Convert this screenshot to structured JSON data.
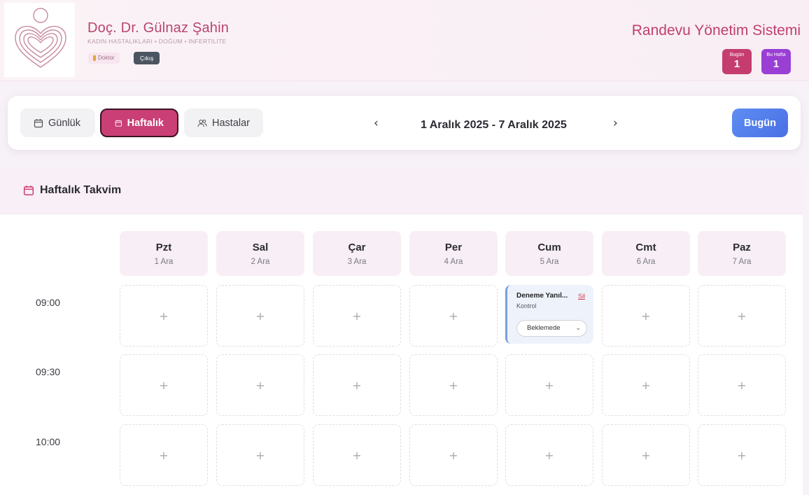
{
  "header": {
    "doctor_name": "Doç. Dr. Gülnaz Şahin",
    "specialty": "KADIN HASTALIKLARI • DOĞUM • İNFERTİLİTE",
    "role": "Doktor",
    "logout_label": "Çıkış",
    "app_title": "Randevu Yönetim Sistemi",
    "stats": [
      {
        "label": "Bugün",
        "value": "1"
      },
      {
        "label": "Bu Hafta",
        "value": "1"
      }
    ]
  },
  "toolbar": {
    "views": [
      {
        "label": "Günlük",
        "active": false
      },
      {
        "label": "Haftalık",
        "active": true
      },
      {
        "label": "Hastalar",
        "active": false
      }
    ],
    "date_range": "1 Aralık 2025 - 7 Aralık 2025",
    "prev_icon": "‹",
    "next_icon": "›",
    "today_label": "Bugün"
  },
  "calendar": {
    "title": "Haftalık Takvim",
    "days": [
      {
        "name": "Pzt",
        "date": "1 Ara"
      },
      {
        "name": "Sal",
        "date": "2 Ara"
      },
      {
        "name": "Çar",
        "date": "3 Ara"
      },
      {
        "name": "Per",
        "date": "4 Ara"
      },
      {
        "name": "Cum",
        "date": "5 Ara"
      },
      {
        "name": "Cmt",
        "date": "6 Ara"
      },
      {
        "name": "Paz",
        "date": "7 Ara"
      }
    ],
    "times": [
      "09:00",
      "09:30",
      "10:00"
    ],
    "empty_slot_symbol": "+",
    "appointment": {
      "patient": "Deneme Yanıl...",
      "delete_label": "Sil",
      "type": "Kontrol",
      "status": "Beklemede"
    }
  },
  "colors": {
    "brand": "#c03e6e",
    "active_tab": "#c93f76",
    "today_button": "#4a6fe5",
    "stat_today": "#c53d6f",
    "stat_week": "#9a3fd4"
  }
}
